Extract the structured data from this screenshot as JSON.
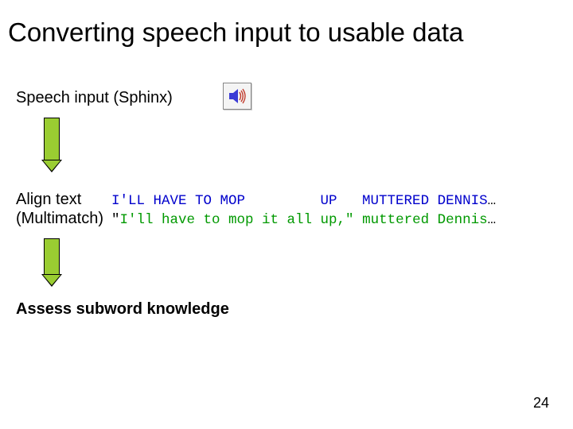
{
  "title": "Converting speech input to usable data",
  "labels": {
    "speech": "Speech input (Sphinx)",
    "align_line1": "Align text",
    "align_line2": "(Multimatch)",
    "assess": "Assess subword knowledge"
  },
  "aligned": {
    "row1": {
      "pre": "",
      "blue": "I'LL HAVE TO MOP         UP   MUTTERED DENNIS",
      "post": "…"
    },
    "row2": {
      "pre": "\"",
      "green": "I'll have to mop it all up,\" muttered Dennis",
      "post": "…"
    }
  },
  "icon": {
    "speaker": "speaker-icon"
  },
  "page_number": "24"
}
